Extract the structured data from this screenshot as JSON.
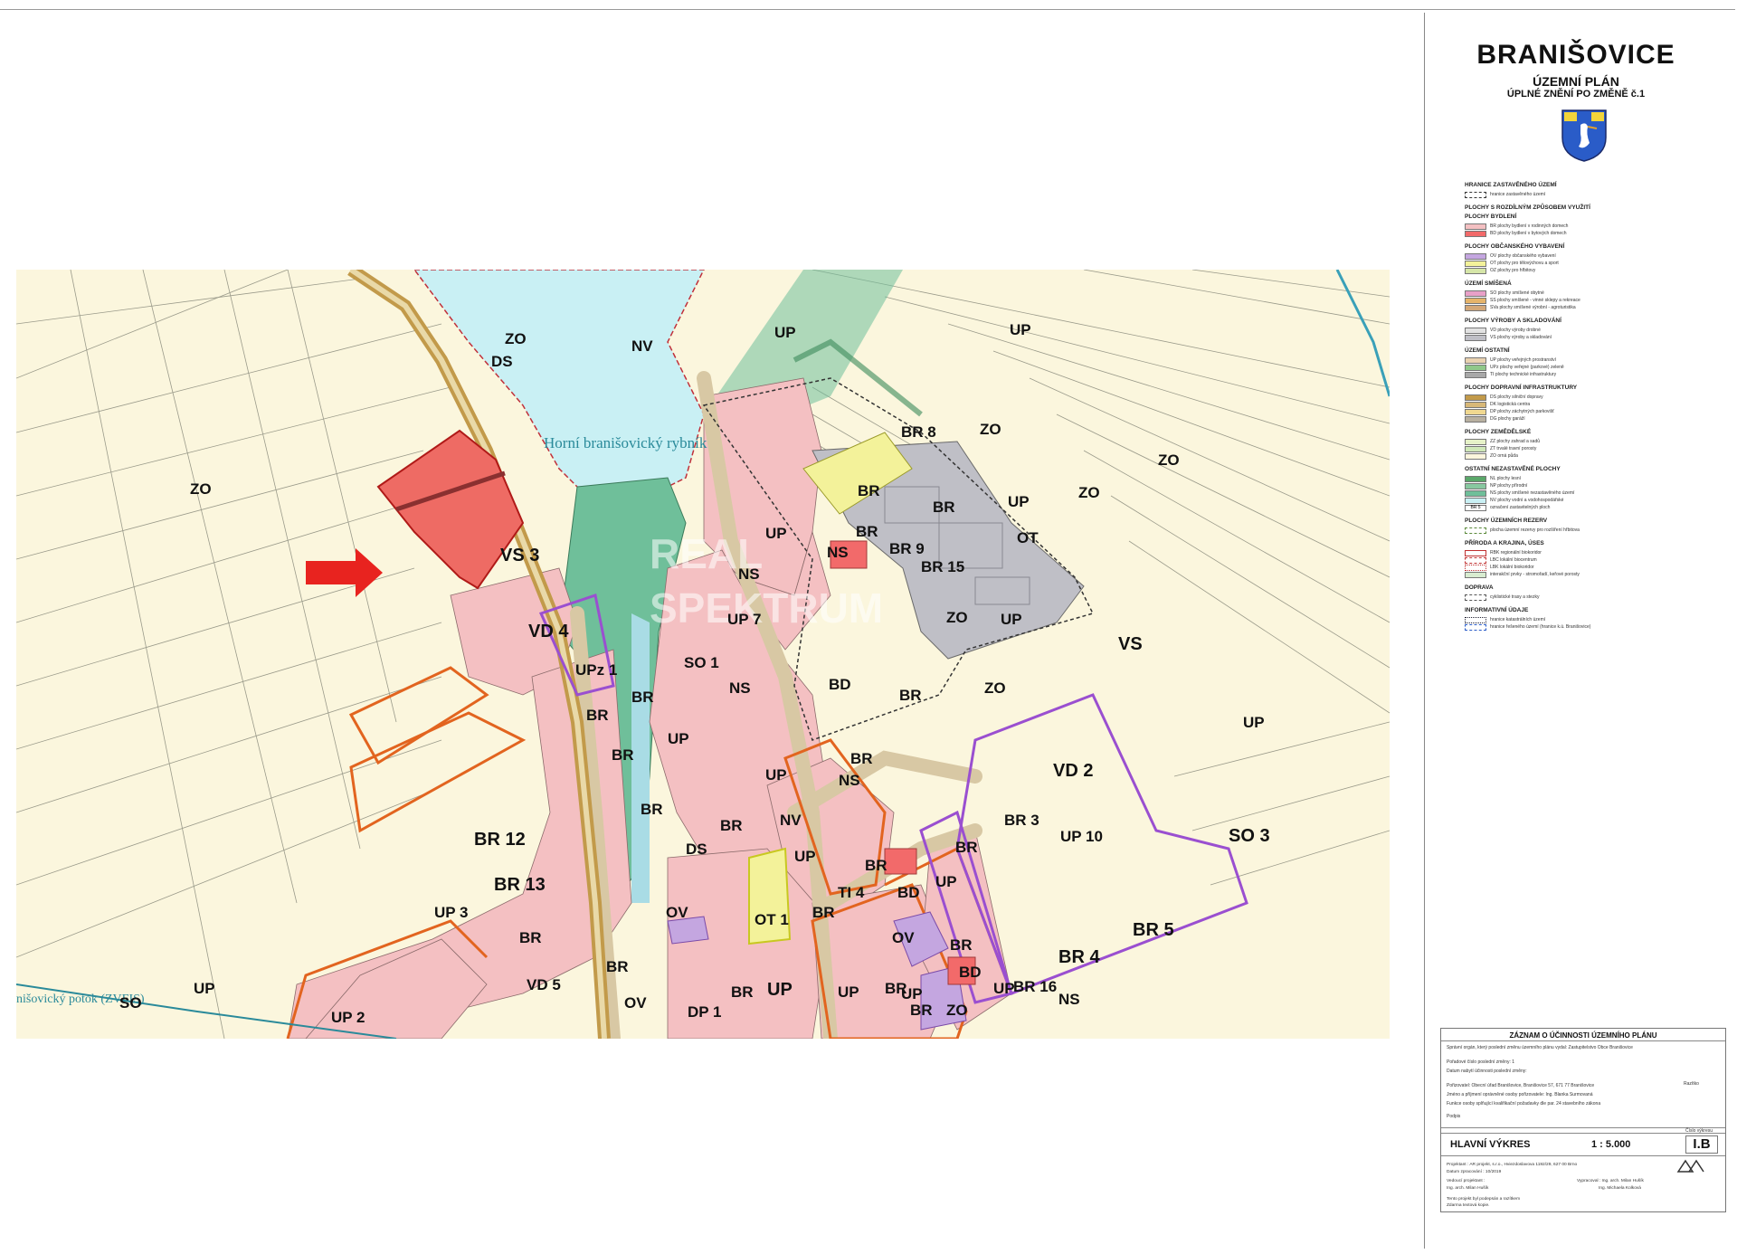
{
  "map": {
    "zone_labels": [
      {
        "id": "zo-1",
        "text": "ZO"
      },
      {
        "id": "ds-1",
        "text": "DS"
      },
      {
        "id": "nv-1",
        "text": "NV"
      },
      {
        "id": "up-1",
        "text": "UP"
      },
      {
        "id": "up-2",
        "text": "UP"
      },
      {
        "id": "br8",
        "text": "BR 8"
      },
      {
        "id": "zo-2",
        "text": "ZO"
      },
      {
        "id": "zo-3",
        "text": "ZO"
      },
      {
        "id": "zo-4",
        "text": "ZO"
      },
      {
        "id": "br-1",
        "text": "BR"
      },
      {
        "id": "br-2",
        "text": "BR"
      },
      {
        "id": "up-3",
        "text": "UP"
      },
      {
        "id": "zo-5",
        "text": "ZO"
      },
      {
        "id": "ot-1",
        "text": "OT"
      },
      {
        "id": "vs3",
        "text": "VS 3"
      },
      {
        "id": "vd4",
        "text": "VD 4"
      },
      {
        "id": "up-4",
        "text": "UP"
      },
      {
        "id": "br-3",
        "text": "BR"
      },
      {
        "id": "br9",
        "text": "BR 9"
      },
      {
        "id": "ns-1",
        "text": "NS"
      },
      {
        "id": "ns-2",
        "text": "NS"
      },
      {
        "id": "br15",
        "text": "BR 15"
      },
      {
        "id": "zo-6",
        "text": "ZO"
      },
      {
        "id": "up-5",
        "text": "UP"
      },
      {
        "id": "vs-1",
        "text": "VS"
      },
      {
        "id": "up7",
        "text": "UP 7"
      },
      {
        "id": "upz1",
        "text": "UPz 1"
      },
      {
        "id": "so1",
        "text": "SO 1"
      },
      {
        "id": "ns-3",
        "text": "NS"
      },
      {
        "id": "bd-1",
        "text": "BD"
      },
      {
        "id": "br-4",
        "text": "BR"
      },
      {
        "id": "zo-7",
        "text": "ZO"
      },
      {
        "id": "br-5",
        "text": "BR"
      },
      {
        "id": "br-6",
        "text": "BR"
      },
      {
        "id": "br-7",
        "text": "BR"
      },
      {
        "id": "up-6",
        "text": "UP"
      },
      {
        "id": "up-7",
        "text": "UP"
      },
      {
        "id": "br-8",
        "text": "BR"
      },
      {
        "id": "ns-4",
        "text": "NS"
      },
      {
        "id": "vd2",
        "text": "VD 2"
      },
      {
        "id": "up-8",
        "text": "UP"
      },
      {
        "id": "br-9",
        "text": "BR"
      },
      {
        "id": "br12",
        "text": "BR 12"
      },
      {
        "id": "nv-2",
        "text": "NV"
      },
      {
        "id": "br-10",
        "text": "BR"
      },
      {
        "id": "br3",
        "text": "BR 3"
      },
      {
        "id": "up10",
        "text": "UP 10"
      },
      {
        "id": "so3",
        "text": "SO 3"
      },
      {
        "id": "ds-2",
        "text": "DS"
      },
      {
        "id": "up-9",
        "text": "UP"
      },
      {
        "id": "br-11",
        "text": "BR"
      },
      {
        "id": "br-12",
        "text": "BR"
      },
      {
        "id": "br13",
        "text": "BR 13"
      },
      {
        "id": "bd-2",
        "text": "BD"
      },
      {
        "id": "up-10",
        "text": "UP"
      },
      {
        "id": "ti4",
        "text": "TI 4"
      },
      {
        "id": "up3",
        "text": "UP 3"
      },
      {
        "id": "ov-1",
        "text": "OV"
      },
      {
        "id": "ot1",
        "text": "OT 1"
      },
      {
        "id": "br-13",
        "text": "BR"
      },
      {
        "id": "br5",
        "text": "BR 5"
      },
      {
        "id": "br-14",
        "text": "BR"
      },
      {
        "id": "ov-2",
        "text": "OV"
      },
      {
        "id": "br-15",
        "text": "BR"
      },
      {
        "id": "br4",
        "text": "BR 4"
      },
      {
        "id": "br-16",
        "text": "BR"
      },
      {
        "id": "bd-3",
        "text": "BD"
      },
      {
        "id": "up-11",
        "text": "UP"
      },
      {
        "id": "up-12",
        "text": "UP"
      },
      {
        "id": "up-13",
        "text": "UP"
      },
      {
        "id": "so-2",
        "text": "SO"
      },
      {
        "id": "vd5",
        "text": "VD 5"
      },
      {
        "id": "br-17",
        "text": "BR"
      },
      {
        "id": "up-14",
        "text": "UP"
      },
      {
        "id": "up-15",
        "text": "UP"
      },
      {
        "id": "br-18",
        "text": "BR"
      },
      {
        "id": "br16",
        "text": "BR 16"
      },
      {
        "id": "ov-3",
        "text": "OV"
      },
      {
        "id": "dp1",
        "text": "DP 1"
      },
      {
        "id": "br-19",
        "text": "BR"
      },
      {
        "id": "zo-8",
        "text": "ZO"
      },
      {
        "id": "ns-5",
        "text": "NS"
      },
      {
        "id": "up2",
        "text": "UP 2"
      }
    ],
    "lake_name": "Horní branišovický rybník",
    "stream_name": "nišovický potok (ZVFIS)",
    "watermark_line1": "REAL",
    "watermark_line2": "SPEKTRUM",
    "colors": {
      "field": "#fbf6dd",
      "lake": "#c9f0f4",
      "residential": "#f4c0c2",
      "green": "#6fbf9a",
      "industrial": "#bfbfc6",
      "road": "#d8c8a4",
      "target": "#ee6b64",
      "arrow": "#e8231f",
      "orange_border": "#e2641f",
      "purple_border": "#9a4fd0",
      "sport": "#f3f29a"
    }
  },
  "sidebar": {
    "town": "BRANIŠOVICE",
    "plan": "ÚZEMNÍ PLÁN",
    "sub": "ÚPLNÉ ZNĚNÍ PO ZMĚNĚ č.1",
    "crest_icon": "coat-of-arms-heron",
    "legend": {
      "h1": "HRANICE ZASTAVĚNÉHO ÚZEMÍ",
      "r1": "hranice zastavěného území",
      "h2": "PLOCHY S ROZDÍLNÝM ZPŮSOBEM VYUŽITÍ",
      "h2a": "PLOCHY BYDLENÍ",
      "r2a": "BR plochy bydlení v rodinných domech",
      "r2b": "BD plochy bydlení v bytových domech",
      "h3": "PLOCHY OBČANSKÉHO VYBAVENÍ",
      "r3a": "OV plochy občanského vybavení",
      "r3b": "OT plochy pro tělovýchovu a sport",
      "r3c": "OZ plochy pro hřbitovy",
      "h4": "ÚZEMÍ SMÍŠENÁ",
      "r4a": "SO plochy smíšené obytné",
      "r4b": "SS plochy smíšené - vinné sklepy a rekreace",
      "r4c": "SVa plochy smíšené výrobní - agroturistika",
      "h5": "PLOCHY VÝROBY A SKLADOVÁNÍ",
      "r5a": "VD plochy výroby drobné",
      "r5b": "VS plochy výroby a skladování",
      "h6": "ÚZEMÍ OSTATNÍ",
      "r6a": "UP plochy veřejných prostranství",
      "r6b": "UPz plochy veřejné (parkové) zeleně",
      "r6c": "TI plochy technické infrastruktury",
      "h7": "PLOCHY DOPRAVNÍ INFRASTRUKTURY",
      "r7a": "DS plochy silniční dopravy",
      "r7b": "DK logistická centra",
      "r7c": "DP plochy záchytných parkovišť",
      "r7d": "DG plochy garáží",
      "h8": "PLOCHY ZEMĚDĚLSKÉ",
      "r8a": "ZZ plochy zahrad a sadů",
      "r8b": "ZT trvalé travní porosty",
      "r8c": "ZO orná půda",
      "h9": "OSTATNÍ NEZASTAVĚNÉ PLOCHY",
      "r9a": "NL plochy lesní",
      "r9b": "NP plochy přírodní",
      "r9c": "NS plochy smíšené nezastavěného území",
      "r9d": "NV plochy vodní a vodohospodářské",
      "r9e": "označení zastavitelných ploch",
      "sw_br5": "BR 5",
      "h10": "PLOCHY ÚZEMNÍCH REZERV",
      "r10": "plocha územní rezervy pro rozšíření hřbitova",
      "h11": "PŘÍRODA A KRAJINA, ÚSES",
      "r11a": "RBK regionální biokoridor",
      "r11b": "LBC lokální biocentrum",
      "r11c": "LBK lokální biokoridor",
      "r11d": "interakční prvky - stromořadí, keřové porosty",
      "h12": "DOPRAVA",
      "r12": "cyklistické trasy a stezky",
      "h13": "INFORMATIVNÍ ÚDAJE",
      "r13a": "hranice katastrálních území",
      "r13b": "hranice řešeného území (hranice k.ú. Branišovice)"
    }
  },
  "record": {
    "title": "ZÁZNAM O ÚČINNOSTI ÚZEMNÍHO PLÁNU",
    "l1": "Správní orgán, který poslední změnu územního plánu vydal:  Zastupitelstvo Obce Branišovice",
    "l2": "Pořadové číslo poslední změny:  1",
    "l3": "Datum nabytí účinnosti poslední změny:",
    "l4": "Pořizovatel: Obecní úřad Branišovice, Branišovice 57, 671 77 Branišovice",
    "l5": "Jméno a příjmení oprávněné osoby pořizovatele: Ing. Blanka Surmovaná",
    "l6": "Funkce osoby splňující kvalifikační požadavky dle par. 24 stavebního zákona",
    "l7": "Podpis",
    "stamp": "Razítko",
    "drawing_title": "HLAVNÍ VÝKRES",
    "scale": "1 : 5.000",
    "number_label": "Číslo výkresu",
    "number": "I.B",
    "f1": "Projektant : AR projekt, s.r.o., Hviezdoslavova 1192/29, 627 00 Brno",
    "f2": "Datum zpracování : 10/2019",
    "f3": "Vedoucí projektant :",
    "f4": "Ing. arch. Milan Hušík",
    "f5": "Vypracoval : Ing. arch. Milan Hušík",
    "f6": "Ing. Michaela Kolková",
    "f7": "Tento projekt byl podepsán a razítkem",
    "f8": "Zdarma textová kopie.",
    "logo_text": "AR projekt s.r.o."
  }
}
